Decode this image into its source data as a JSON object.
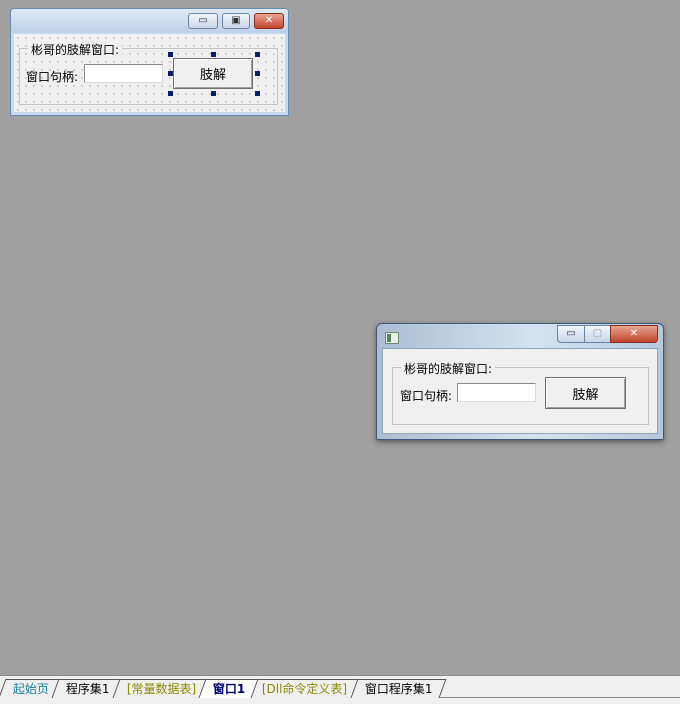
{
  "design_window": {
    "group_title": "彬哥的肢解窗口:",
    "handle_label": "窗口句柄:",
    "handle_value": "",
    "action_button": "肢解",
    "minimize_glyph": "▭",
    "maximize_glyph": "▣",
    "close_glyph": "✕"
  },
  "run_window": {
    "group_title": "彬哥的肢解窗口:",
    "handle_label": "窗口句柄:",
    "handle_value": "",
    "action_button": "肢解",
    "minimize_glyph": "▭",
    "maximize_glyph": "▢",
    "close_glyph": "✕"
  },
  "tabs": [
    {
      "label": "起始页",
      "color": "#1a7fa0"
    },
    {
      "label": "程序集1",
      "color": "#000000"
    },
    {
      "label": "[常量数据表]",
      "color": "#8a8a00"
    },
    {
      "label": "窗口1",
      "color": "#00007a",
      "active": true
    },
    {
      "label": "[Dll命令定义表]",
      "color": "#8a8a00"
    },
    {
      "label": "窗口程序集1",
      "color": "#000000"
    }
  ],
  "colors": {
    "desktop": "#a0a0a0",
    "selection_handle": "#0a1e6e",
    "close_button": "#c2452c"
  }
}
